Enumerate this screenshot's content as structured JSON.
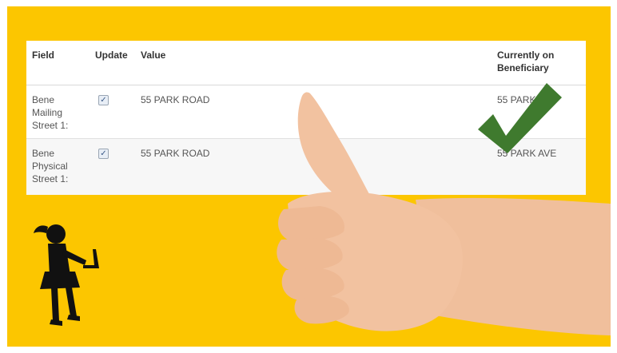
{
  "table": {
    "columns": [
      "Field",
      "Update",
      "Value",
      "Currently on Beneficiary"
    ],
    "rows": [
      {
        "field": "Bene Mailing Street 1:",
        "update_checked": true,
        "value": "55 PARK ROAD",
        "current": "55 PARK AVE"
      },
      {
        "field": "Bene Physical Street 1:",
        "update_checked": true,
        "value": "55 PARK ROAD",
        "current": "55 PARK AVE"
      }
    ]
  },
  "colors": {
    "background": "#fcc600",
    "checkmark": "#3f7a2e",
    "skin": "#f2c2a0",
    "silhouette": "#111111"
  },
  "icons": {
    "checkbox": "checkbox-checked-icon",
    "checkmark": "checkmark-icon",
    "hand": "thumbs-up-hand-icon",
    "person": "person-with-laptop-icon"
  }
}
